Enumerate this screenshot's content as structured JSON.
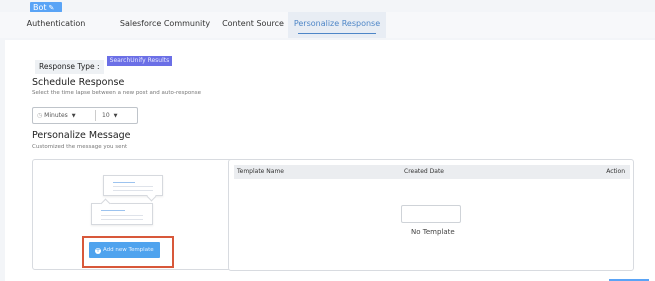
{
  "header": {
    "bot_label": "Bot",
    "edit_icon": "pencil-icon"
  },
  "tabs": [
    {
      "label": "Authentication",
      "active": false
    },
    {
      "label": "Salesforce Community",
      "active": false
    },
    {
      "label": "Content Source",
      "active": false
    },
    {
      "label": "Personalize Response",
      "active": true
    }
  ],
  "response_type": {
    "label": "Response Type :",
    "value": "SearchUnify Results"
  },
  "schedule": {
    "title": "Schedule Response",
    "description": "Select the time lapse between a new post and auto-response",
    "unit_value": "Minutes",
    "amount_value": "10"
  },
  "personalize": {
    "title": "Personalize Message",
    "description": "Customized the message you sent",
    "add_button": "Add new Template"
  },
  "template_table": {
    "columns": [
      "Template Name",
      "Created Date",
      "Action"
    ],
    "empty_text": "No Template"
  },
  "colors": {
    "accent": "#4e86c7",
    "button": "#4fa3ee",
    "badge": "#6b6fe6",
    "highlight": "#d8583a"
  }
}
